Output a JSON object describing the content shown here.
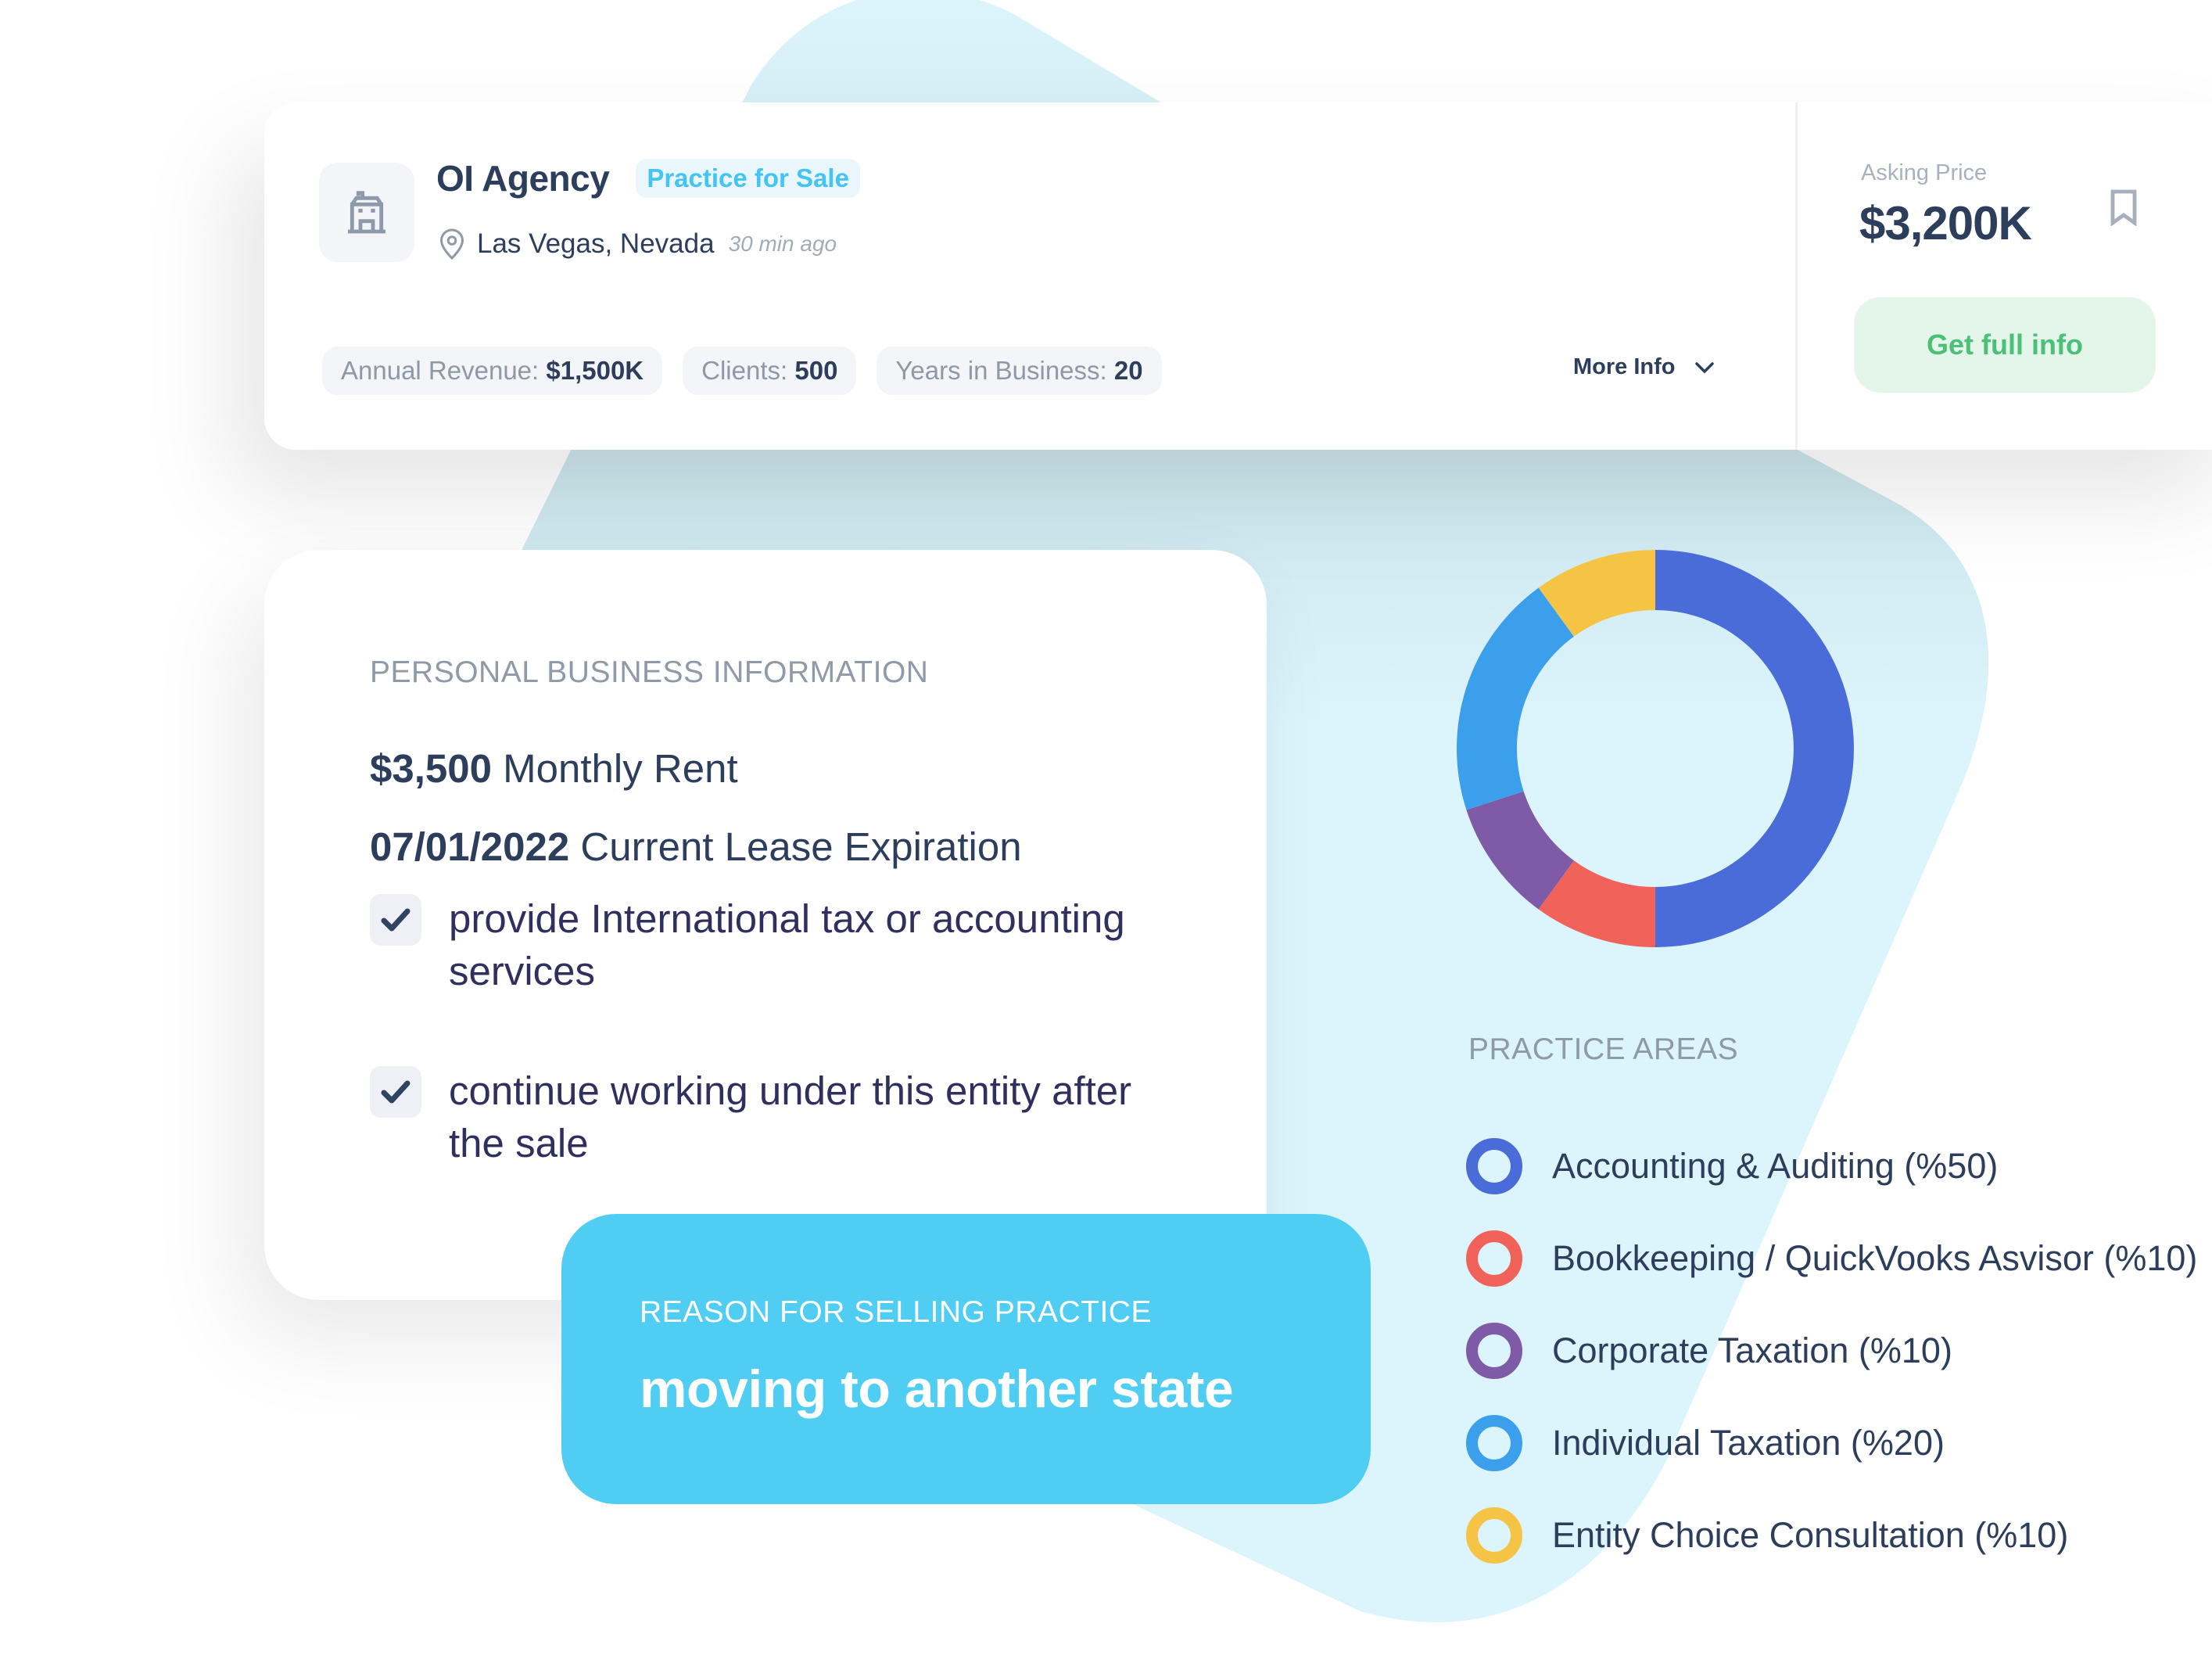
{
  "listing": {
    "icon": "building-icon",
    "name": "OI Agency",
    "badge": "Practice for Sale",
    "location_icon": "location-pin-icon",
    "location": "Las Vegas, Nevada",
    "posted": "30 min ago",
    "stats": [
      {
        "label": "Annual Revenue:",
        "value": "$1,500K"
      },
      {
        "label": "Clients:",
        "value": "500"
      },
      {
        "label": "Years in Business:",
        "value": "20"
      }
    ],
    "more_info_label": "More Info",
    "asking_price_label": "Asking Price",
    "asking_price_value": "$3,200K",
    "bookmark_icon": "bookmark-icon",
    "get_full_info_label": "Get full info"
  },
  "personal_info": {
    "heading": "PERSONAL BUSINESS INFORMATION",
    "rent_value": "$3,500",
    "rent_label": "Monthly Rent",
    "lease_value": "07/01/2022",
    "lease_label": "Current Lease Expiration",
    "checks": [
      {
        "text": "provide International tax or accounting services",
        "checked": true
      },
      {
        "text": "continue working under this entity after the sale",
        "checked": true
      }
    ]
  },
  "reason": {
    "heading": "REASON FOR SELLING PRACTICE",
    "text": "moving to another state"
  },
  "colors": {
    "accent_blue": "#4fcdf3",
    "navy_text": "#2c3e5c",
    "green_button_text": "#4cbf78",
    "background_shape": "#dcf4fb"
  },
  "chart_data": {
    "type": "pie",
    "variant": "donut",
    "title": "PRACTICE AREAS",
    "start_angle": "top",
    "direction": "clockwise",
    "categories": [
      "Accounting & Auditing",
      "Bookkeeping / QuickVooks Asvisor",
      "Corporate Taxation",
      "Individual Taxation",
      "Entity Choice Consultation"
    ],
    "values": [
      50,
      10,
      10,
      20,
      10
    ],
    "unit": "%",
    "colors": [
      "#4a6cd9",
      "#f0625a",
      "#7f5aa6",
      "#3b9fec",
      "#f6c445"
    ],
    "legend": [
      {
        "label": "Accounting & Auditing  (%50)"
      },
      {
        "label": "Bookkeeping / QuickVooks Asvisor (%10)"
      },
      {
        "label": "Corporate Taxation (%10)"
      },
      {
        "label": "Individual Taxation (%20)"
      },
      {
        "label": "Entity Choice Consultation (%10)"
      }
    ],
    "legend_position": "bottom"
  }
}
